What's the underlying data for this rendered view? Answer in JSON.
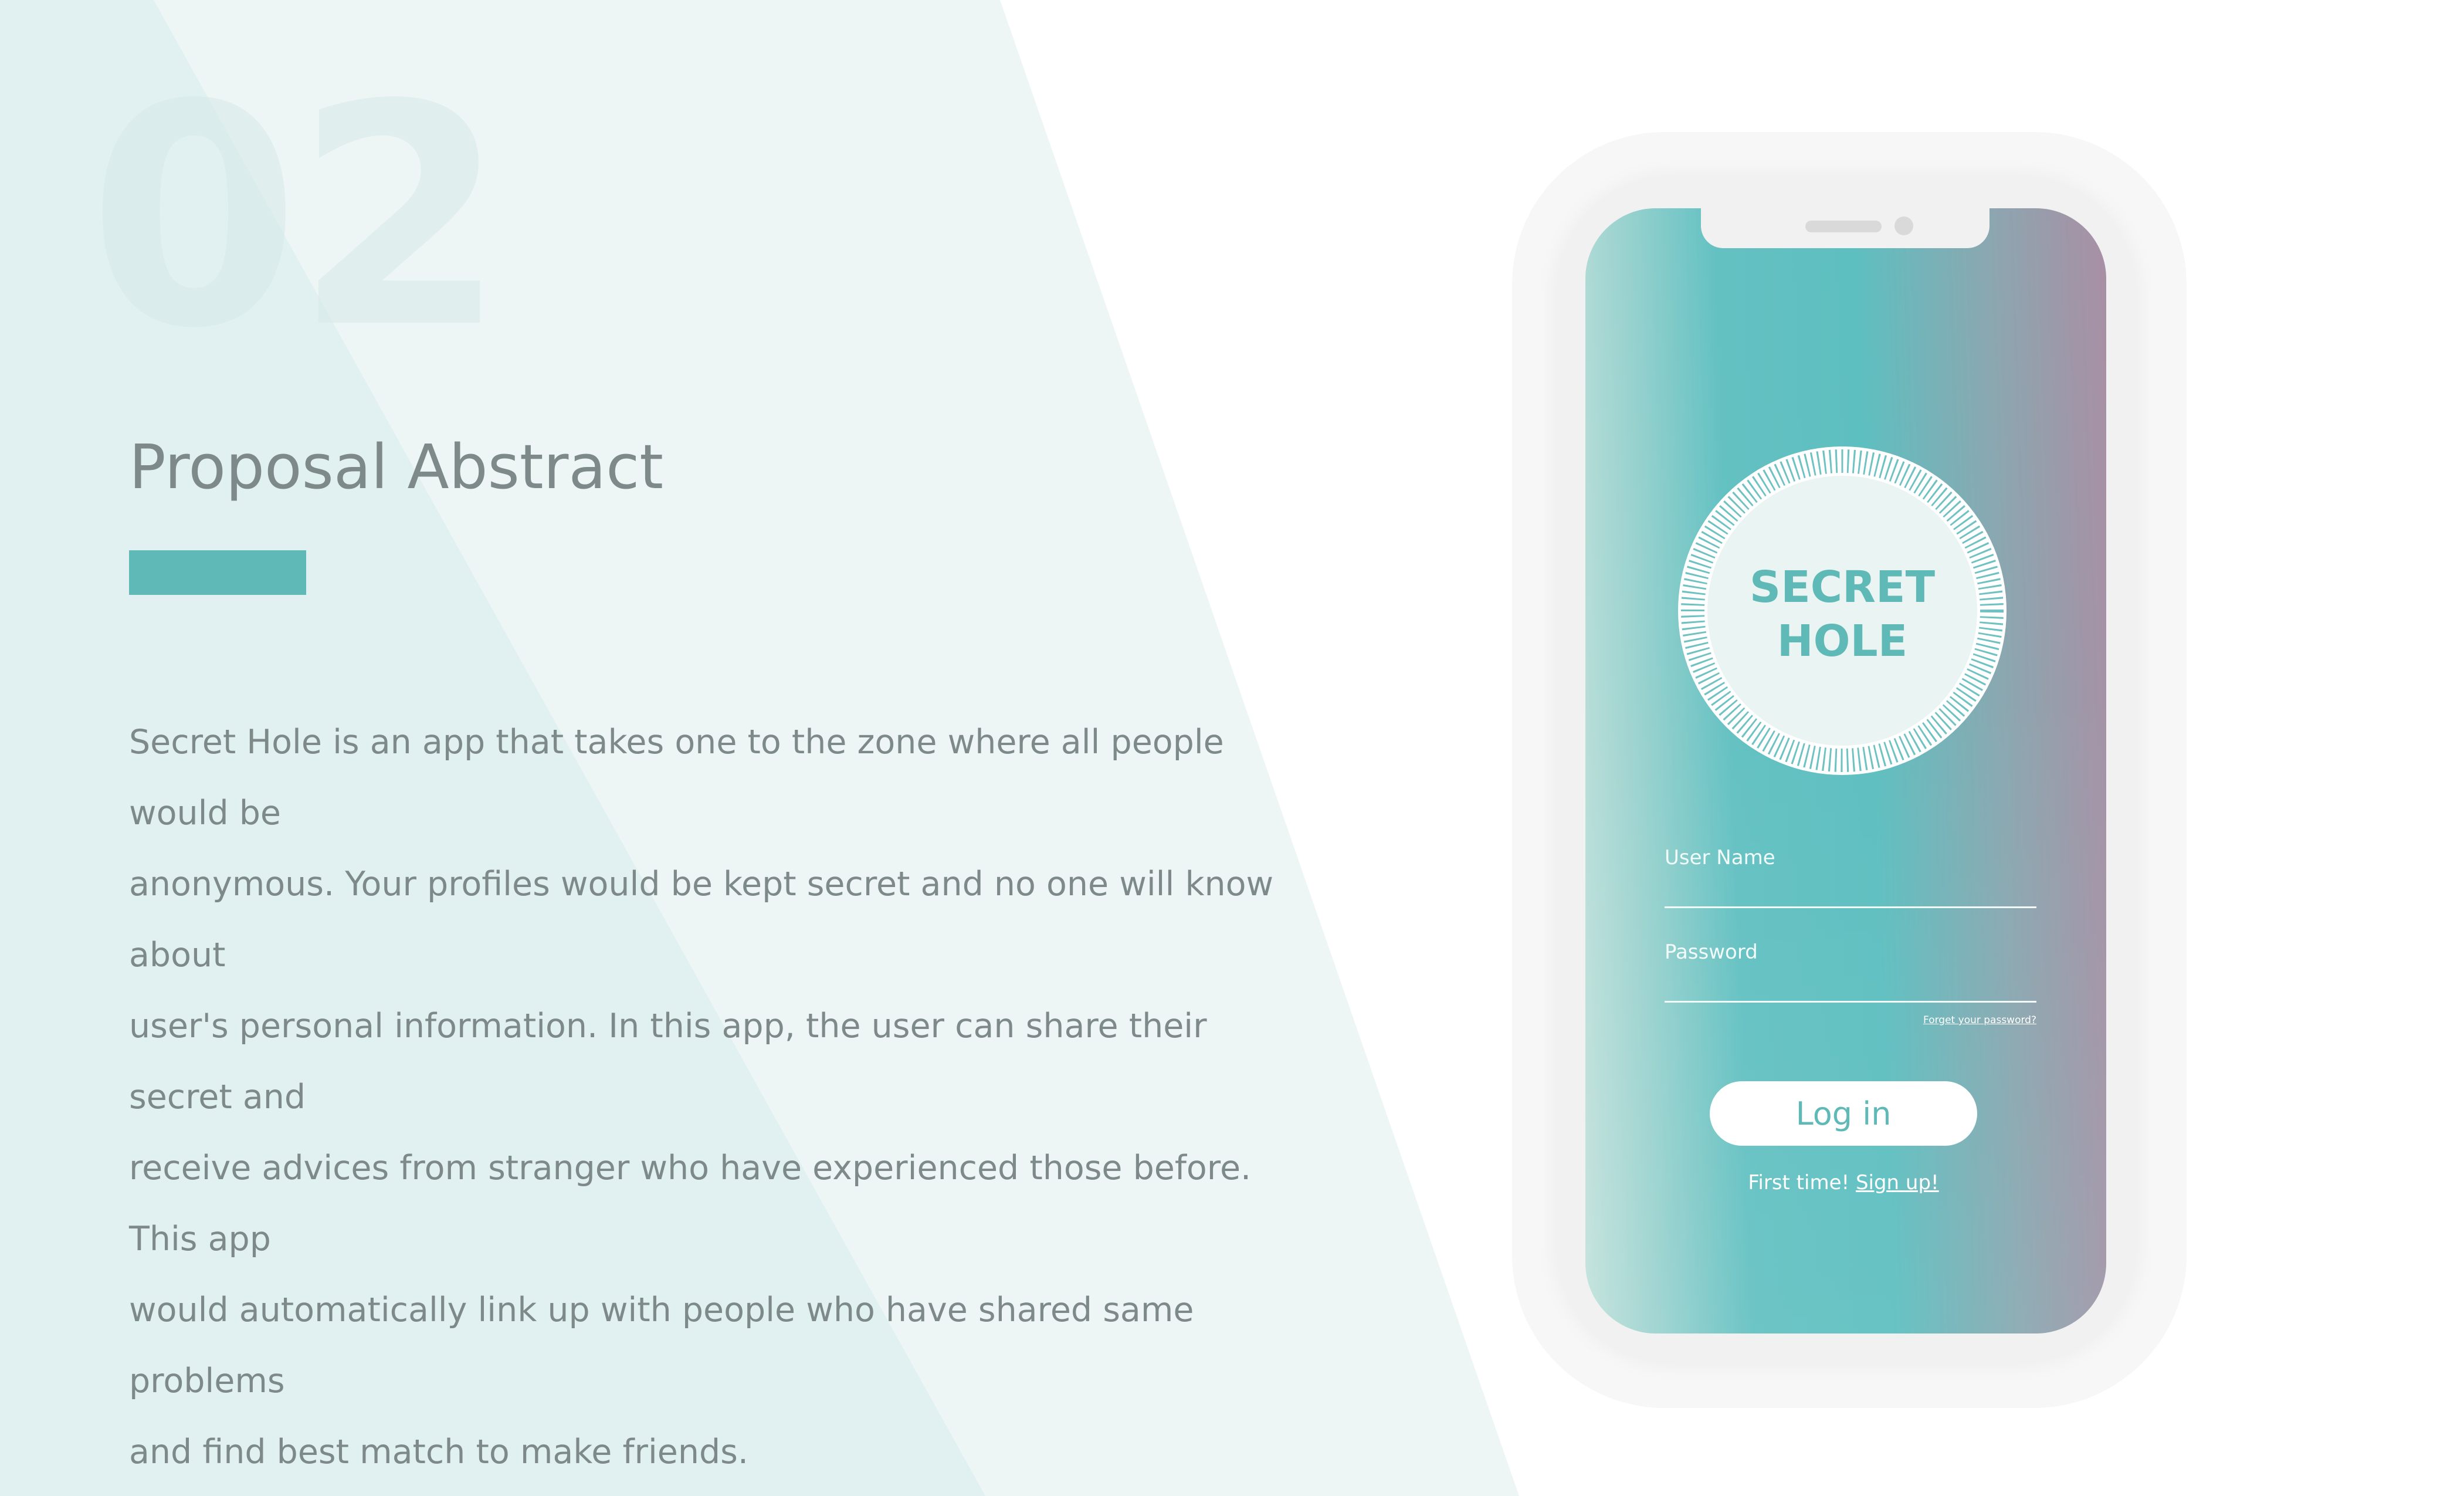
{
  "slide": {
    "number": "02",
    "title": "Proposal Abstract",
    "body_lines": [
      "Secret Hole is an app that takes one to the zone where all people would be",
      "anonymous. Your profiles would be kept secret and no one will know about",
      "user's personal information. In this app, the user can share their secret and",
      "receive advices from stranger who have experienced those before. This app",
      "would automatically link up with people who have shared same problems",
      "and find best match to make friends."
    ]
  },
  "phone_app": {
    "logo_line1": "SECRET",
    "logo_line2": "HOLE",
    "username_label": "User Name",
    "password_label": "Password",
    "forgot_password": "Forget your password?",
    "login_button": "Log in",
    "first_time_text": "First time!",
    "signup_link": "Sign up!"
  },
  "colors": {
    "accent": "#5fb9b7",
    "text_gray": "#7e8a8a",
    "background_light": "#e1f0f0",
    "background_lighter": "#edf6f5",
    "gradient_start": "#c3e2dc",
    "gradient_mid": "#5ebfc0",
    "gradient_end": "#a98fa4"
  }
}
